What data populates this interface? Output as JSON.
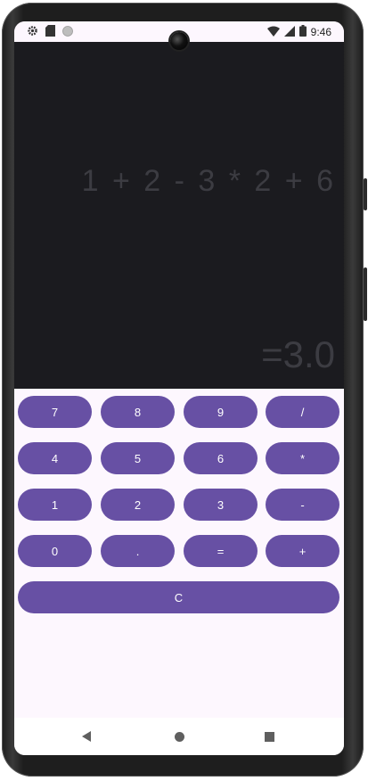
{
  "status_bar": {
    "time": "9:46",
    "left_icons": [
      "gear-icon",
      "sd-card-icon",
      "circle-icon"
    ],
    "right_icons": [
      "wifi-icon",
      "signal-icon",
      "battery-icon"
    ]
  },
  "display": {
    "expression": "1 + 2 - 3 * 2 + 6",
    "result": "=3.0"
  },
  "keypad": {
    "rows": [
      [
        "7",
        "8",
        "9",
        "/"
      ],
      [
        "4",
        "5",
        "6",
        "*"
      ],
      [
        "1",
        "2",
        "3",
        "-"
      ],
      [
        "0",
        ".",
        "=",
        "+"
      ]
    ],
    "clear": "C"
  },
  "nav_bar": {
    "icons": [
      "back-icon",
      "home-icon",
      "recents-icon"
    ]
  },
  "colors": {
    "key_background": "#6750a4",
    "display_background": "#1b1b1f",
    "app_background": "#fdf7fe",
    "display_text": "#3c3c42"
  }
}
